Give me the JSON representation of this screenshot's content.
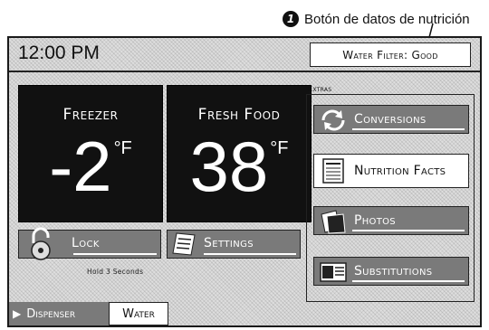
{
  "callout": {
    "number": "1",
    "text": "Botón de datos de nutrición"
  },
  "status": {
    "time": "12:00 PM",
    "water_filter": "Water Filter: Good"
  },
  "temperatures": {
    "freezer": {
      "label": "Freezer",
      "value": "-2",
      "unit": "°F"
    },
    "fresh_food": {
      "label": "Fresh Food",
      "value": "38",
      "unit": "°F"
    }
  },
  "controls": {
    "lock": {
      "label": "Lock",
      "hint": "Hold 3 Seconds"
    },
    "settings": {
      "label": "Settings"
    }
  },
  "extras": {
    "heading": "Extras",
    "items": [
      {
        "label": "Conversions",
        "icon": "conversions-icon",
        "style": "gray"
      },
      {
        "label": "Nutrition Facts",
        "icon": "nutrition-facts-icon",
        "style": "white"
      },
      {
        "label": "Photos",
        "icon": "photos-icon",
        "style": "gray"
      },
      {
        "label": "Substitutions",
        "icon": "substitutions-icon",
        "style": "gray"
      }
    ]
  },
  "dispenser": {
    "label": "Dispenser",
    "mode": "Water"
  },
  "colors": {
    "panel_dark": "#111111",
    "button_gray": "#7a7a7a",
    "highlight_white": "#ffffff"
  }
}
